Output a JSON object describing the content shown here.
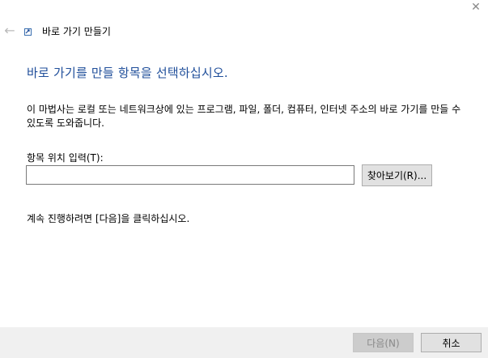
{
  "window": {
    "close_glyph": "✕"
  },
  "nav": {
    "back_glyph": "←"
  },
  "wizard": {
    "title": "바로 가기 만들기"
  },
  "page": {
    "heading": "바로 가기를 만들 항목을 선택하십시오.",
    "description": "이 마법사는 로컬 또는 네트워크상에 있는 프로그램, 파일, 폴더, 컴퓨터, 인터넷 주소의 바로 가기를 만들 수 있도록 도와줍니다.",
    "location_label": "항목 위치 입력(T):",
    "location_value": "",
    "browse_label": "찾아보기(R)...",
    "hint": "계속 진행하려면 [다음]을 클릭하십시오."
  },
  "footer": {
    "next_label": "다음(N)",
    "cancel_label": "취소"
  },
  "colors": {
    "heading": "#1f4e9a",
    "footer_bg": "#f0f0f0",
    "disabled_text": "#8a8a8a"
  }
}
